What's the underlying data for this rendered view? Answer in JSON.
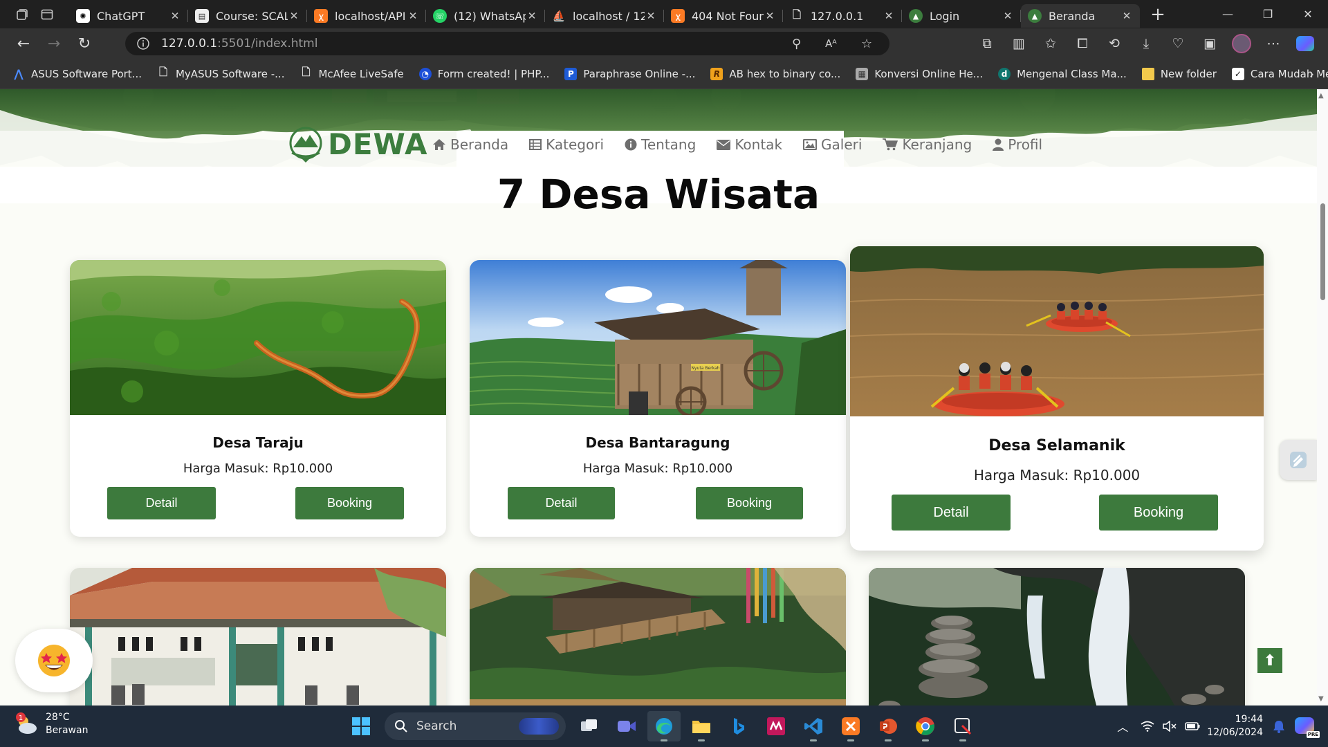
{
  "browser": {
    "tabs": [
      {
        "title": "ChatGPT",
        "icon": "chatgpt-icon"
      },
      {
        "title": "Course: SCAL",
        "icon": "moodle-icon"
      },
      {
        "title": "localhost/API",
        "icon": "xampp-icon"
      },
      {
        "title": "(12) WhatsAp",
        "icon": "whatsapp-icon"
      },
      {
        "title": "localhost / 12",
        "icon": "phpmyadmin-icon"
      },
      {
        "title": "404 Not Foun",
        "icon": "xampp-icon"
      },
      {
        "title": "127.0.0.1",
        "icon": "page-icon"
      },
      {
        "title": "Login",
        "icon": "dewa-icon"
      },
      {
        "title": "Beranda",
        "icon": "dewa-icon"
      }
    ],
    "url_host": "127.0.0.1",
    "url_rest": ":5501/index.html",
    "bookmarks": [
      {
        "label": "ASUS Software Port..."
      },
      {
        "label": "MyASUS Software -..."
      },
      {
        "label": "McAfee LiveSafe"
      },
      {
        "label": "Form created! | PHP..."
      },
      {
        "label": "Paraphrase Online -..."
      },
      {
        "label": "AB hex to binary co..."
      },
      {
        "label": "Konversi Online He..."
      },
      {
        "label": "Mengenal Class Ma..."
      },
      {
        "label": "New folder"
      },
      {
        "label": "Cara Mudah Memb..."
      }
    ]
  },
  "site": {
    "logo_text": "DEWA",
    "menu": [
      {
        "label": "Beranda",
        "icon": "home-icon"
      },
      {
        "label": "Kategori",
        "icon": "table-icon"
      },
      {
        "label": "Tentang",
        "icon": "info-icon"
      },
      {
        "label": "Kontak",
        "icon": "envelope-icon"
      },
      {
        "label": "Galeri",
        "icon": "image-icon"
      },
      {
        "label": "Keranjang",
        "icon": "cart-icon"
      },
      {
        "label": "Profil",
        "icon": "user-icon"
      }
    ],
    "title": "7 Desa Wisata",
    "cards": [
      {
        "name": "Desa Taraju",
        "price": "Harga Masuk: Rp10.000",
        "detail": "Detail",
        "booking": "Booking"
      },
      {
        "name": "Desa Bantaragung",
        "price": "Harga Masuk: Rp10.000",
        "detail": "Detail",
        "booking": "Booking"
      },
      {
        "name": "Desa Selamanik",
        "price": "Harga Masuk: Rp10.000",
        "detail": "Detail",
        "booking": "Booking"
      }
    ],
    "image_sign": "Nyuta Berkah",
    "scroll_top_glyph": "⬆",
    "accent": "#3d7a3d"
  },
  "taskbar": {
    "weather_badge": "1",
    "weather_temp": "28°C",
    "weather_desc": "Berawan",
    "search_placeholder": "Search",
    "time": "19:44",
    "date": "12/06/2024",
    "copilot_badge": "PRE"
  }
}
